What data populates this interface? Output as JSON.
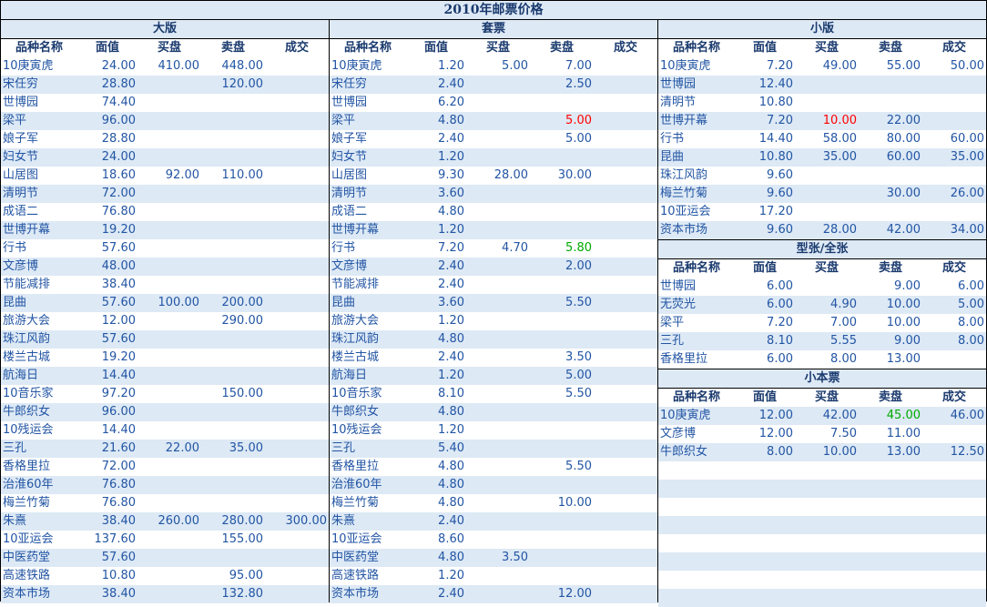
{
  "title": "2010年邮票价格",
  "headers": [
    "品种名称",
    "面值",
    "买盘",
    "卖盘",
    "成交"
  ],
  "colors": {
    "text": "#2255a4",
    "stripe": "#dde9f5",
    "up": "#ff0000",
    "down": "#00aa00"
  },
  "dabang": {
    "title": "大版",
    "rows": [
      [
        "10庚寅虎",
        "24.00",
        "410.00",
        "448.00",
        ""
      ],
      [
        "宋任穷",
        "28.80",
        "",
        "120.00",
        ""
      ],
      [
        "世博园",
        "74.40",
        "",
        "",
        ""
      ],
      [
        "梁平",
        "96.00",
        "",
        "",
        ""
      ],
      [
        "娘子军",
        "28.80",
        "",
        "",
        ""
      ],
      [
        "妇女节",
        "24.00",
        "",
        "",
        ""
      ],
      [
        "山居图",
        "18.60",
        "92.00",
        "110.00",
        ""
      ],
      [
        "清明节",
        "72.00",
        "",
        "",
        ""
      ],
      [
        "成语二",
        "76.80",
        "",
        "",
        ""
      ],
      [
        "世博开幕",
        "19.20",
        "",
        "",
        ""
      ],
      [
        "行书",
        "57.60",
        "",
        "",
        ""
      ],
      [
        "文彦博",
        "48.00",
        "",
        "",
        ""
      ],
      [
        "节能减排",
        "38.40",
        "",
        "",
        ""
      ],
      [
        "昆曲",
        "57.60",
        "100.00",
        "200.00",
        ""
      ],
      [
        "旅游大会",
        "12.00",
        "",
        "290.00",
        ""
      ],
      [
        "珠江风韵",
        "57.60",
        "",
        "",
        ""
      ],
      [
        "楼兰古城",
        "19.20",
        "",
        "",
        ""
      ],
      [
        "航海日",
        "14.40",
        "",
        "",
        ""
      ],
      [
        "10音乐家",
        "97.20",
        "",
        "150.00",
        ""
      ],
      [
        "牛郎织女",
        "96.00",
        "",
        "",
        ""
      ],
      [
        "10残运会",
        "14.40",
        "",
        "",
        ""
      ],
      [
        "三孔",
        "21.60",
        "22.00",
        "35.00",
        ""
      ],
      [
        "香格里拉",
        "72.00",
        "",
        "",
        ""
      ],
      [
        "治淮60年",
        "76.80",
        "",
        "",
        ""
      ],
      [
        "梅兰竹菊",
        "76.80",
        "",
        "",
        ""
      ],
      [
        "朱熹",
        "38.40",
        "260.00",
        "280.00",
        "300.00"
      ],
      [
        "10亚运会",
        "137.60",
        "",
        "155.00",
        ""
      ],
      [
        "中医药堂",
        "57.60",
        "",
        "",
        ""
      ],
      [
        "高速铁路",
        "10.80",
        "",
        "95.00",
        ""
      ],
      [
        "资本市场",
        "38.40",
        "",
        "132.80",
        ""
      ]
    ]
  },
  "taopiao": {
    "title": "套票",
    "rows": [
      [
        "10庚寅虎",
        "1.20",
        "5.00",
        "7.00",
        ""
      ],
      [
        "宋任穷",
        "2.40",
        "",
        "2.50",
        ""
      ],
      [
        "世博园",
        "6.20",
        "",
        "",
        ""
      ],
      [
        "梁平",
        "4.80",
        "",
        "5.00",
        ""
      ],
      [
        "娘子军",
        "2.40",
        "",
        "5.00",
        ""
      ],
      [
        "妇女节",
        "1.20",
        "",
        "",
        ""
      ],
      [
        "山居图",
        "9.30",
        "28.00",
        "30.00",
        ""
      ],
      [
        "清明节",
        "3.60",
        "",
        "",
        ""
      ],
      [
        "成语二",
        "4.80",
        "",
        "",
        ""
      ],
      [
        "世博开幕",
        "1.20",
        "",
        "",
        ""
      ],
      [
        "行书",
        "7.20",
        "4.70",
        "5.80",
        ""
      ],
      [
        "文彦博",
        "2.40",
        "",
        "2.00",
        ""
      ],
      [
        "节能减排",
        "2.40",
        "",
        "",
        ""
      ],
      [
        "昆曲",
        "3.60",
        "",
        "5.50",
        ""
      ],
      [
        "旅游大会",
        "1.20",
        "",
        "",
        ""
      ],
      [
        "珠江风韵",
        "4.80",
        "",
        "",
        ""
      ],
      [
        "楼兰古城",
        "2.40",
        "",
        "3.50",
        ""
      ],
      [
        "航海日",
        "1.20",
        "",
        "5.00",
        ""
      ],
      [
        "10音乐家",
        "8.10",
        "",
        "5.50",
        ""
      ],
      [
        "牛郎织女",
        "4.80",
        "",
        "",
        ""
      ],
      [
        "10残运会",
        "1.20",
        "",
        "",
        ""
      ],
      [
        "三孔",
        "5.40",
        "",
        "",
        ""
      ],
      [
        "香格里拉",
        "4.80",
        "",
        "5.50",
        ""
      ],
      [
        "治淮60年",
        "4.80",
        "",
        "",
        ""
      ],
      [
        "梅兰竹菊",
        "4.80",
        "",
        "10.00",
        ""
      ],
      [
        "朱熹",
        "2.40",
        "",
        "",
        ""
      ],
      [
        "10亚运会",
        "8.60",
        "",
        "",
        ""
      ],
      [
        "中医药堂",
        "4.80",
        "3.50",
        "",
        ""
      ],
      [
        "高速铁路",
        "1.20",
        "",
        "",
        ""
      ],
      [
        "资本市场",
        "2.40",
        "",
        "12.00",
        ""
      ]
    ],
    "highlights": {
      "3-3": "red",
      "10-3": "green"
    }
  },
  "xiaoban": {
    "title": "小版",
    "rows": [
      [
        "10庚寅虎",
        "7.20",
        "49.00",
        "55.00",
        "50.00"
      ],
      [
        "世博园",
        "12.40",
        "",
        "",
        ""
      ],
      [
        "清明节",
        "10.80",
        "",
        "",
        ""
      ],
      [
        "世博开幕",
        "7.20",
        "10.00",
        "22.00",
        ""
      ],
      [
        "行书",
        "14.40",
        "58.00",
        "80.00",
        "60.00"
      ],
      [
        "昆曲",
        "10.80",
        "35.00",
        "60.00",
        "35.00"
      ],
      [
        "珠江风韵",
        "9.60",
        "",
        "",
        ""
      ],
      [
        "梅兰竹菊",
        "9.60",
        "",
        "30.00",
        "26.00"
      ],
      [
        "10亚运会",
        "17.20",
        "",
        "",
        ""
      ],
      [
        "资本市场",
        "9.60",
        "28.00",
        "42.00",
        "34.00"
      ]
    ],
    "highlights": {
      "3-2": "red"
    }
  },
  "xingzhang": {
    "title": "型张/全张",
    "rows": [
      [
        "世博园",
        "6.00",
        "",
        "9.00",
        "6.00"
      ],
      [
        "无荧光",
        "6.00",
        "4.90",
        "10.00",
        "5.00"
      ],
      [
        "梁平",
        "7.20",
        "7.00",
        "10.00",
        "8.00"
      ],
      [
        "三孔",
        "8.10",
        "5.55",
        "9.00",
        "8.00"
      ],
      [
        "香格里拉",
        "6.00",
        "8.00",
        "13.00",
        ""
      ]
    ]
  },
  "xiaobenpiao": {
    "title": "小本票",
    "rows": [
      [
        "10庚寅虎",
        "12.00",
        "42.00",
        "45.00",
        "46.00"
      ],
      [
        "文彦博",
        "12.00",
        "7.50",
        "11.00",
        ""
      ],
      [
        "牛郎织女",
        "8.00",
        "10.00",
        "13.00",
        "12.50"
      ]
    ],
    "highlights": {
      "0-3": "green"
    }
  }
}
